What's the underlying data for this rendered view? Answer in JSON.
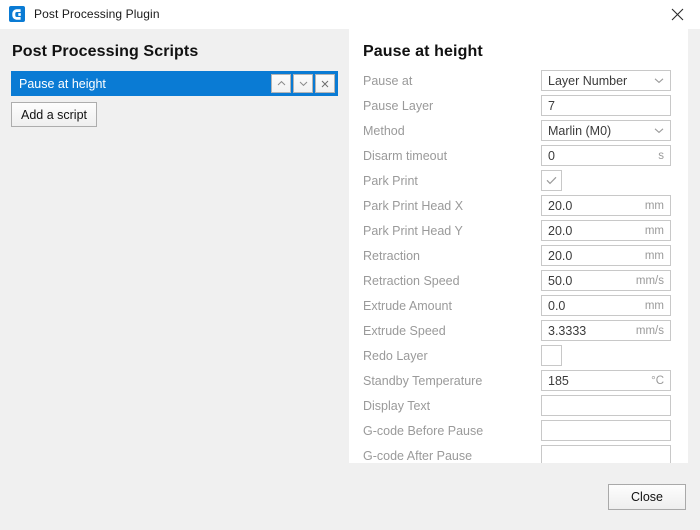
{
  "window": {
    "title": "Post Processing Plugin",
    "icon": "cura-logo-icon",
    "close_icon": "close-icon",
    "accent_color": "#0a7bd4",
    "background_color": "#f0f0f0",
    "panel_color": "#ffffff"
  },
  "left_panel": {
    "heading": "Post Processing Scripts",
    "scripts": [
      {
        "name": "Pause at height",
        "selected": true,
        "move_up_icon": "chevron-up-icon",
        "move_down_icon": "chevron-down-icon",
        "remove_icon": "close-icon"
      }
    ],
    "add_script_label": "Add a script"
  },
  "right_panel": {
    "heading": "Pause at height",
    "fields": [
      {
        "label": "Pause at",
        "type": "select",
        "value": "Layer Number",
        "unit": ""
      },
      {
        "label": "Pause Layer",
        "type": "text",
        "value": "7",
        "unit": ""
      },
      {
        "label": "Method",
        "type": "select",
        "value": "Marlin (M0)",
        "unit": ""
      },
      {
        "label": "Disarm timeout",
        "type": "text",
        "value": "0",
        "unit": "s"
      },
      {
        "label": "Park Print",
        "type": "checkbox",
        "checked": true
      },
      {
        "label": "Park Print Head X",
        "type": "text",
        "value": "20.0",
        "unit": "mm"
      },
      {
        "label": "Park Print Head Y",
        "type": "text",
        "value": "20.0",
        "unit": "mm"
      },
      {
        "label": "Retraction",
        "type": "text",
        "value": "20.0",
        "unit": "mm"
      },
      {
        "label": "Retraction Speed",
        "type": "text",
        "value": "50.0",
        "unit": "mm/s"
      },
      {
        "label": "Extrude Amount",
        "type": "text",
        "value": "0.0",
        "unit": "mm"
      },
      {
        "label": "Extrude Speed",
        "type": "text",
        "value": "3.3333",
        "unit": "mm/s"
      },
      {
        "label": "Redo Layer",
        "type": "checkbox",
        "checked": false
      },
      {
        "label": "Standby Temperature",
        "type": "text",
        "value": "185",
        "unit": "°C"
      },
      {
        "label": "Display Text",
        "type": "text",
        "value": "",
        "unit": ""
      },
      {
        "label": "G-code Before Pause",
        "type": "text",
        "value": "",
        "unit": ""
      },
      {
        "label": "G-code After Pause",
        "type": "text",
        "value": "",
        "unit": ""
      }
    ]
  },
  "footer": {
    "close_label": "Close"
  }
}
